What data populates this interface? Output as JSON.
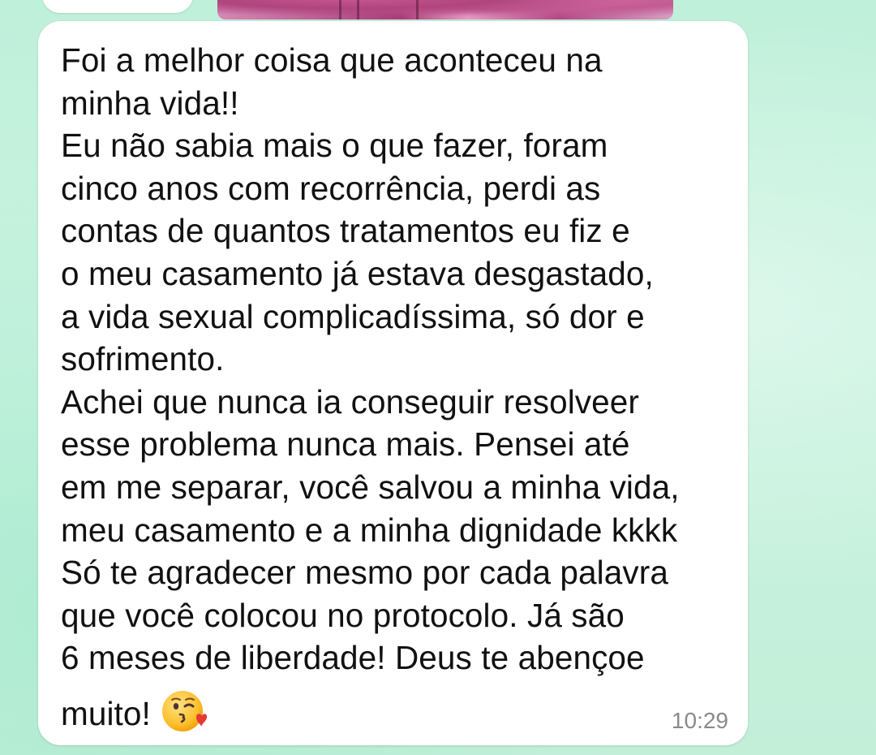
{
  "conversation": {
    "message": {
      "lines": [
        "Foi a melhor coisa que aconteceu na",
        "minha vida!!",
        "Eu não sabia mais o que fazer, foram",
        "cinco anos com recorrência, perdi as",
        "contas de quantos tratamentos eu fiz e",
        "o meu casamento já estava desgastado,",
        "a vida sexual complicadíssima, só dor e",
        "sofrimento.",
        "Achei que nunca ia conseguir resolveer",
        "esse problema nunca mais. Pensei até",
        "em me separar, você salvou a minha vida,",
        "meu casamento e a minha dignidade kkkk",
        "Só te agradecer mesmo por cada palavra",
        "que você colocou no protocolo. Já são",
        "6 meses de liberdade! Deus te abençoe",
        "muito!"
      ],
      "emoji": "face-blowing-a-kiss",
      "time": "10:29"
    }
  },
  "colors": {
    "chat_background": "#c4f0dc",
    "bubble": "#ffffff",
    "text": "#111111",
    "timestamp": "#8a8a8a"
  }
}
